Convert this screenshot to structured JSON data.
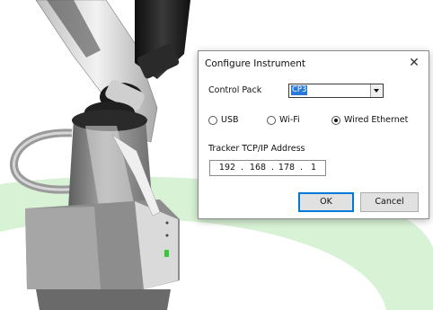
{
  "dialog": {
    "title": "Configure Instrument",
    "close_glyph": "✕",
    "control_pack": {
      "label": "Control Pack",
      "selected": "CP3"
    },
    "connection": {
      "options": [
        {
          "label": "USB",
          "selected": false
        },
        {
          "label": "Wi-Fi",
          "selected": false
        },
        {
          "label": "Wired Ethernet",
          "selected": true
        }
      ]
    },
    "tracker_ip": {
      "label": "Tracker TCP/IP Address",
      "octets": [
        "192",
        "168",
        "178",
        "1"
      ]
    },
    "buttons": {
      "ok": "OK",
      "cancel": "Cancel"
    }
  },
  "colors": {
    "floor_ring": "#d8f2d6",
    "arm_shell": "#e6e6e6",
    "arm_dark": "#1c1c1c",
    "base_gray": "#8f8f8f",
    "status_led": "#37c837",
    "selection": "#2b79d6"
  }
}
